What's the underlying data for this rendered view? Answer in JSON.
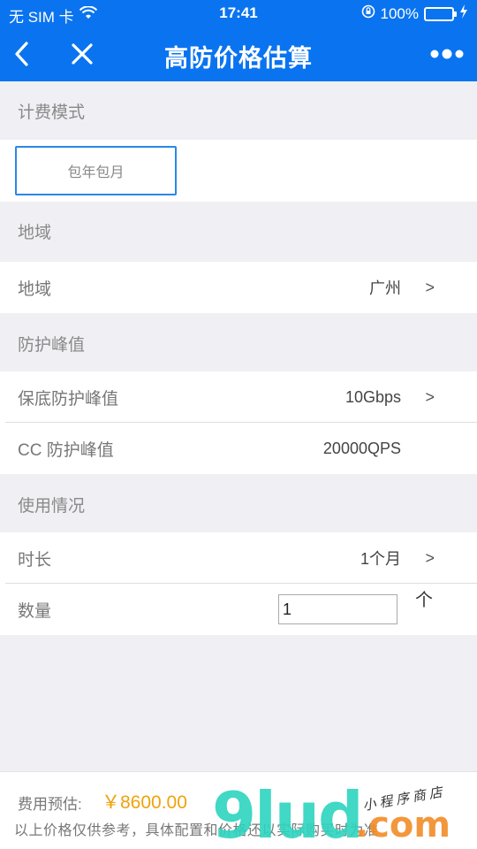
{
  "status_bar": {
    "carrier": "无 SIM 卡",
    "time": "17:41",
    "battery": "100%",
    "icons": [
      "wifi-icon",
      "rotation-lock-icon",
      "battery-icon",
      "charging-icon"
    ]
  },
  "nav": {
    "title": "高防价格估算",
    "icons": [
      "back-icon",
      "close-icon",
      "more-icon"
    ]
  },
  "billing": {
    "header": "计费模式",
    "mode_button": "包年包月"
  },
  "region": {
    "header": "地域",
    "label": "地域",
    "value": "广州",
    "arrow": ">"
  },
  "protection": {
    "header": "防护峰值",
    "rows": [
      {
        "label": "保底防护峰值",
        "value": "10Gbps",
        "arrow": ">"
      },
      {
        "label": "CC 防护峰值",
        "value": "20000QPS"
      }
    ]
  },
  "usage": {
    "header": "使用情况",
    "duration_label": "时长",
    "duration_value": "1个月",
    "duration_arrow": ">",
    "quantity_label": "数量",
    "quantity_value": "1",
    "quantity_unit": "个"
  },
  "footer": {
    "cost_label": "费用预估:",
    "cost_value": "￥8600.00",
    "note": "以上价格仅供参考，具体配置和价格还以实际购买时为准"
  },
  "watermark": {
    "main": "9lud",
    "suffix": ".com",
    "sub": "小程序商店"
  },
  "colors": {
    "brand_blue": "#0a74f0",
    "price_orange": "#f0a20a",
    "page_bg": "#efeff4"
  }
}
